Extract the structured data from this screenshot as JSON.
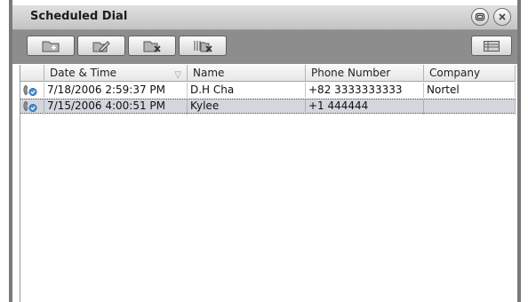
{
  "window": {
    "title": "Scheduled Dial"
  },
  "titlebar": {
    "restore_icon": "restore-icon",
    "close_icon": "close-icon"
  },
  "toolbar": {
    "buttons": [
      {
        "name": "add-schedule-button",
        "icon": "add-folder-icon"
      },
      {
        "name": "edit-schedule-button",
        "icon": "edit-pencil-icon"
      },
      {
        "name": "delete-schedule-button",
        "icon": "delete-x-icon"
      },
      {
        "name": "delete-all-button",
        "icon": "delete-all-icon"
      },
      {
        "name": "columns-button",
        "icon": "column-list-icon"
      }
    ]
  },
  "table": {
    "columns": [
      "",
      "Date & Time",
      "Name",
      "Phone Number",
      "Company"
    ],
    "sort_indicator": "▽",
    "rows": [
      {
        "date_time": "7/18/2006 2:59:37 PM",
        "name": "D.H Cha",
        "phone": "+82 3333333333",
        "company": "Nortel",
        "selected": false
      },
      {
        "date_time": "7/15/2006 4:00:51 PM",
        "name": "Kylee",
        "phone": "+1 444444",
        "company": "",
        "selected": true
      }
    ]
  },
  "colors": {
    "toolbar_bg": "#8d8d8d",
    "selection_bg": "#d4d6de",
    "window_border": "#7a7a7a"
  }
}
